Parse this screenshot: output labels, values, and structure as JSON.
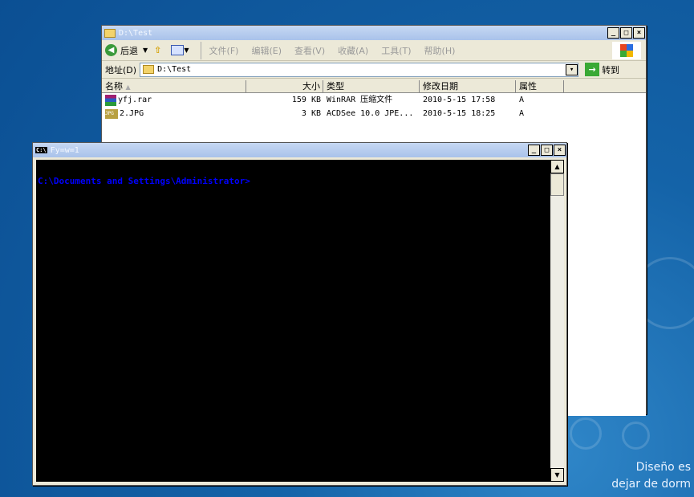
{
  "wallpaper": {
    "line1": "Diseño es",
    "line2": "dejar de dorm"
  },
  "explorer": {
    "title": "D:\\Test",
    "back_label": "后退",
    "menus": [
      "文件(F)",
      "编辑(E)",
      "查看(V)",
      "收藏(A)",
      "工具(T)",
      "帮助(H)"
    ],
    "address_label": "地址(D)",
    "address_value": "D:\\Test",
    "go_label": "转到",
    "columns": [
      "名称",
      "大小",
      "类型",
      "修改日期",
      "属性"
    ],
    "files": [
      {
        "name": "yfj.rar",
        "size": "159 KB",
        "type": "WinRAR 压缩文件",
        "modified": "2010-5-15 17:58",
        "attr": "A",
        "icon": "rar-icon"
      },
      {
        "name": "2.JPG",
        "size": "3 KB",
        "type": "ACDSee 10.0 JPE...",
        "modified": "2010-5-15 18:25",
        "attr": "A",
        "icon": "jpg-icon"
      }
    ]
  },
  "console": {
    "title": "Fy=w=1",
    "icon_text": "C:\\",
    "prompt": "C:\\Documents and Settings\\Administrator>",
    "prompt_color": "#0000ff"
  }
}
